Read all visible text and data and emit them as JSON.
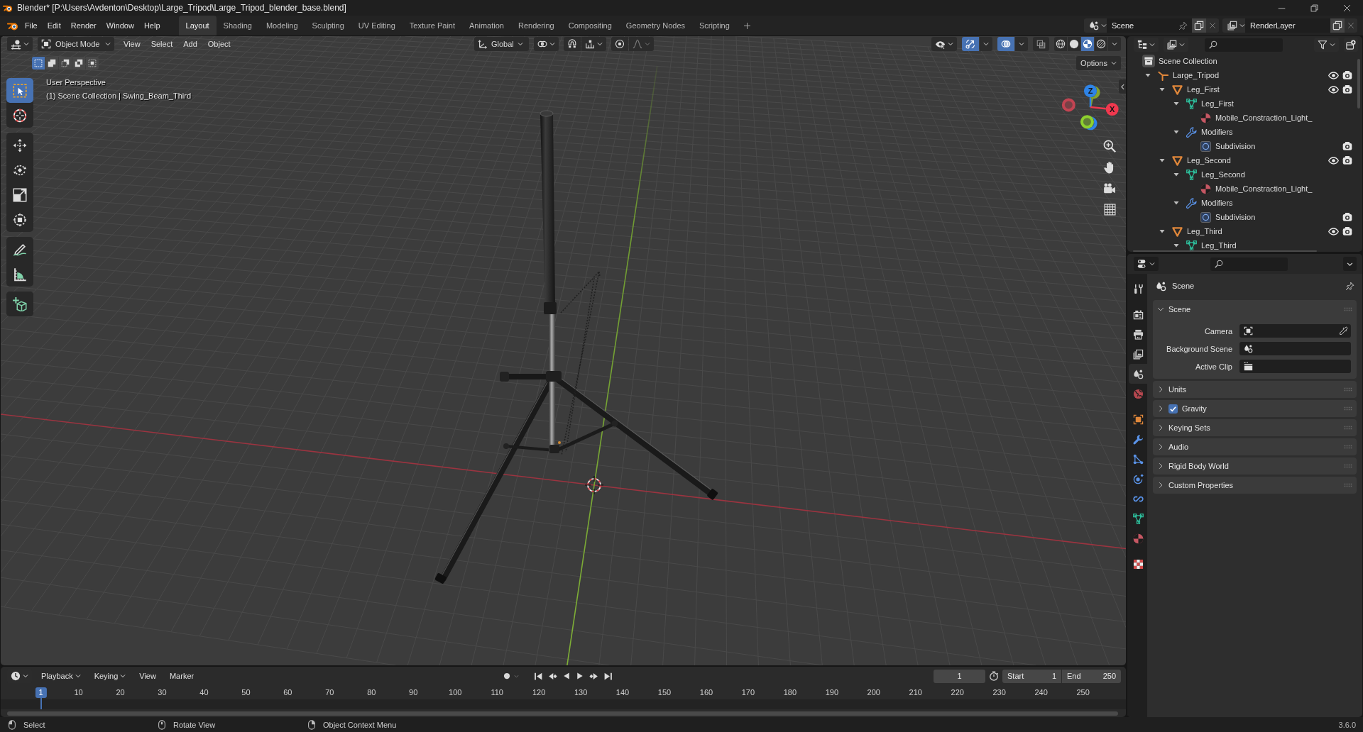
{
  "window": {
    "title": "Blender* [P:\\Users\\Avdenton\\Desktop\\Large_Tripod\\Large_Tripod_blender_base.blend]"
  },
  "menu": [
    "File",
    "Edit",
    "Render",
    "Window",
    "Help"
  ],
  "workspaces": [
    {
      "label": "Layout",
      "selected": true
    },
    {
      "label": "Shading",
      "selected": false
    },
    {
      "label": "Modeling",
      "selected": false
    },
    {
      "label": "Sculpting",
      "selected": false
    },
    {
      "label": "UV Editing",
      "selected": false
    },
    {
      "label": "Texture Paint",
      "selected": false
    },
    {
      "label": "Animation",
      "selected": false
    },
    {
      "label": "Rendering",
      "selected": false
    },
    {
      "label": "Compositing",
      "selected": false
    },
    {
      "label": "Geometry Nodes",
      "selected": false
    },
    {
      "label": "Scripting",
      "selected": false
    }
  ],
  "scene_selector": {
    "value": "Scene"
  },
  "view_layer_selector": {
    "value": "RenderLayer"
  },
  "viewport": {
    "mode": "Object Mode",
    "menus": [
      "View",
      "Select",
      "Add",
      "Object"
    ],
    "orientation": "Global",
    "snap": {
      "on": false
    },
    "proportional_editing": {
      "on": false
    },
    "gizmos": {
      "on": true
    },
    "overlays": {
      "on": true
    },
    "xray": {
      "on": false
    },
    "shading": [
      {
        "kind": "wireframe",
        "selected": false
      },
      {
        "kind": "solid",
        "selected": false
      },
      {
        "kind": "material",
        "selected": true
      },
      {
        "kind": "rendered",
        "selected": false
      }
    ],
    "options": "Options",
    "select_modes": [
      {
        "kind": "new",
        "selected": true
      },
      {
        "kind": "extend",
        "selected": false
      },
      {
        "kind": "subtract",
        "selected": false
      },
      {
        "kind": "difference",
        "selected": false
      },
      {
        "kind": "intersect",
        "selected": false
      }
    ],
    "tool_groups": [
      [
        {
          "kind": "select_box",
          "selected": true
        },
        {
          "kind": "cursor",
          "selected": false
        }
      ],
      [
        {
          "kind": "move",
          "selected": false
        },
        {
          "kind": "rotate",
          "selected": false
        },
        {
          "kind": "scale",
          "selected": false
        },
        {
          "kind": "transform",
          "selected": false
        }
      ],
      [
        {
          "kind": "annotate",
          "selected": false
        },
        {
          "kind": "measure",
          "selected": false
        }
      ],
      [
        {
          "kind": "add_cube",
          "selected": false
        }
      ]
    ],
    "view_name": "User Perspective",
    "view_context": "(1) Scene Collection | Swing_Beam_Third",
    "gizmo_axes": [
      {
        "kind": "neg_x",
        "color": "#c24452"
      },
      {
        "kind": "pos_y",
        "color": "#84a22c"
      },
      {
        "kind": "neg_z",
        "color": "#2e83e6"
      },
      {
        "kind": "neg_y",
        "color": "#8ed12e"
      },
      {
        "kind": "pos_z",
        "label": "Z",
        "color": "#2e83e6"
      },
      {
        "kind": "pos_x",
        "label": "X",
        "color": "#f0384e"
      }
    ]
  },
  "outliner": {
    "items": [
      {
        "label": "Scene Collection",
        "kind": "scene_collection",
        "children": [
          {
            "label": "Large_Tripod",
            "kind": "empty",
            "expanded": true,
            "visible": true,
            "renderable": true,
            "children": [
              {
                "label": "Leg_First",
                "kind": "mesh_object",
                "expanded": true,
                "visible": true,
                "renderable": true,
                "children": [
                  {
                    "label": "Leg_First",
                    "kind": "mesh_data",
                    "expanded": true,
                    "children": [
                      {
                        "label": "Mobile_Constraction_Light_",
                        "kind": "material"
                      }
                    ]
                  },
                  {
                    "label": "Modifiers",
                    "kind": "modifiers",
                    "expanded": true,
                    "children": [
                      {
                        "label": "Subdivision",
                        "kind": "subdivision",
                        "renderable": true
                      }
                    ]
                  }
                ]
              },
              {
                "label": "Leg_Second",
                "kind": "mesh_object",
                "expanded": true,
                "visible": true,
                "renderable": true,
                "children": [
                  {
                    "label": "Leg_Second",
                    "kind": "mesh_data",
                    "expanded": true,
                    "children": [
                      {
                        "label": "Mobile_Constraction_Light_",
                        "kind": "material"
                      }
                    ]
                  },
                  {
                    "label": "Modifiers",
                    "kind": "modifiers",
                    "expanded": true,
                    "children": [
                      {
                        "label": "Subdivision",
                        "kind": "subdivision",
                        "renderable": true
                      }
                    ]
                  }
                ]
              },
              {
                "label": "Leg_Third",
                "kind": "mesh_object",
                "expanded": true,
                "visible": true,
                "renderable": true,
                "children": [
                  {
                    "label": "Leg_Third",
                    "kind": "mesh_data",
                    "expanded": true
                  }
                ]
              }
            ]
          }
        ]
      }
    ]
  },
  "properties": {
    "tab_groups": [
      [
        {
          "kind": "tool",
          "selected": false
        }
      ],
      [
        {
          "kind": "render",
          "selected": false
        },
        {
          "kind": "output",
          "selected": false
        },
        {
          "kind": "view_layer",
          "selected": false
        },
        {
          "kind": "scene",
          "selected": true
        },
        {
          "kind": "world",
          "selected": false
        }
      ],
      [
        {
          "kind": "object",
          "selected": false
        },
        {
          "kind": "modifiers",
          "selected": false
        },
        {
          "kind": "particles",
          "selected": false
        },
        {
          "kind": "physics",
          "selected": false
        },
        {
          "kind": "constraints",
          "selected": false
        },
        {
          "kind": "data",
          "selected": false
        },
        {
          "kind": "material",
          "selected": false
        }
      ],
      [
        {
          "kind": "texture",
          "selected": false
        }
      ]
    ],
    "context": "Scene",
    "panels": [
      {
        "label": "Scene",
        "kind": "plain",
        "expanded": true,
        "fields": [
          {
            "label": "Camera",
            "kind": "object"
          },
          {
            "label": "Background Scene",
            "kind": "scene"
          },
          {
            "label": "Active Clip",
            "kind": "clip"
          }
        ]
      },
      {
        "label": "Units",
        "kind": "plain",
        "expanded": false
      },
      {
        "label": "Gravity",
        "kind": "toggle",
        "checked": true,
        "expanded": false
      },
      {
        "label": "Keying Sets",
        "kind": "plain",
        "expanded": false
      },
      {
        "label": "Audio",
        "kind": "plain",
        "expanded": false
      },
      {
        "label": "Rigid Body World",
        "kind": "plain",
        "expanded": false
      },
      {
        "label": "Custom Properties",
        "kind": "plain",
        "expanded": false
      }
    ]
  },
  "timeline": {
    "menus": [
      {
        "label": "Playback",
        "kind": "dropdown"
      },
      {
        "label": "Keying",
        "kind": "dropdown"
      },
      {
        "label": "View",
        "kind": "plain"
      },
      {
        "label": "Marker",
        "kind": "plain"
      }
    ],
    "auto_keying": {
      "on": false
    },
    "current_frame": "1",
    "start": {
      "label": "Start",
      "value": "1"
    },
    "end": {
      "label": "End",
      "value": "250"
    },
    "playhead": {
      "label": "1",
      "level": 0
    },
    "ruler": [
      "10",
      "20",
      "30",
      "40",
      "50",
      "60",
      "70",
      "80",
      "90",
      "100",
      "110",
      "120",
      "130",
      "140",
      "150",
      "160",
      "170",
      "180",
      "190",
      "200",
      "210",
      "220",
      "230",
      "240",
      "250"
    ]
  },
  "status_bar": {
    "hints": [
      {
        "kind": "left_click",
        "label": "Select"
      },
      {
        "kind": "middle_click",
        "label": "Rotate View"
      },
      {
        "kind": "right_click",
        "label": "Object Context Menu"
      }
    ],
    "version": "3.6.0"
  }
}
